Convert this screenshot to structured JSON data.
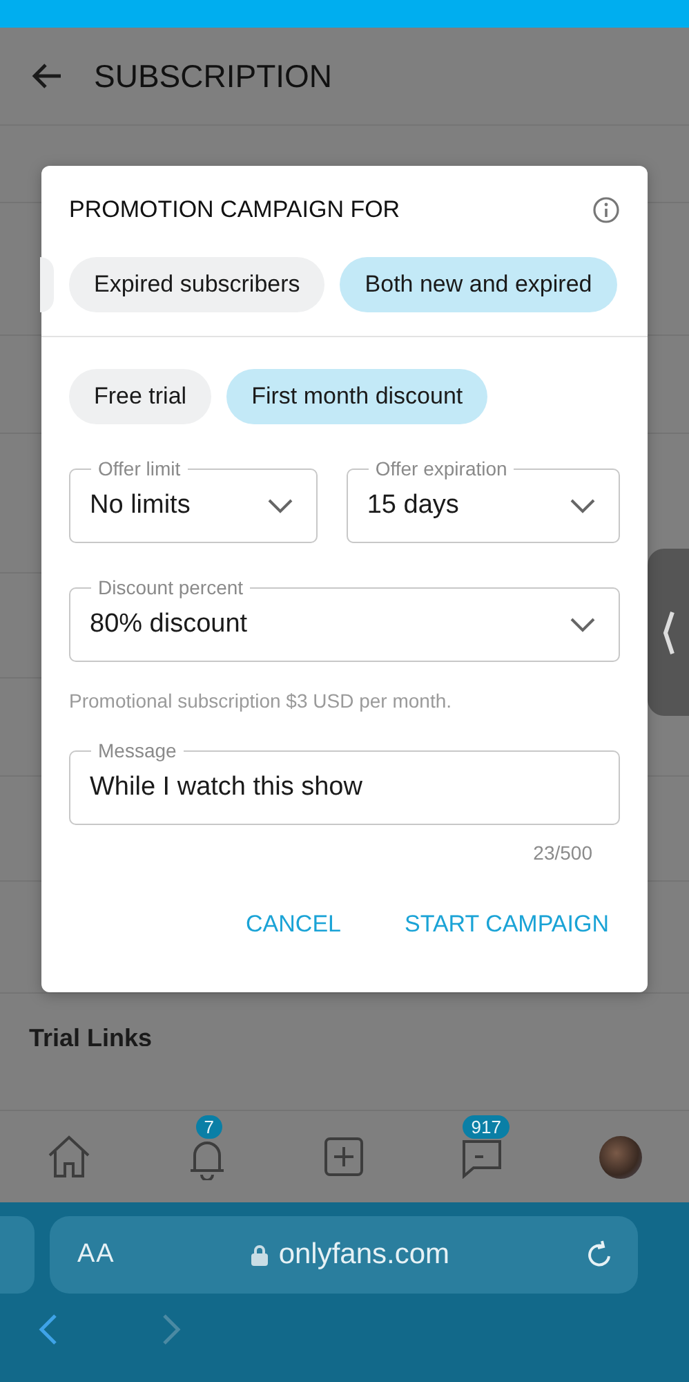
{
  "header": {
    "title": "SUBSCRIPTION"
  },
  "background": {
    "section_title": "Trial Links"
  },
  "dialog": {
    "title": "PROMOTION CAMPAIGN FOR",
    "audience": [
      {
        "label": "Expired subscribers",
        "selected": false
      },
      {
        "label": "Both new and expired",
        "selected": true
      }
    ],
    "offer_types": [
      {
        "label": "Free trial",
        "selected": false
      },
      {
        "label": "First month discount",
        "selected": true
      }
    ],
    "fields": [
      {
        "label": "Offer limit",
        "value": "No limits"
      },
      {
        "label": "Offer expiration",
        "value": "15 days"
      }
    ],
    "discount": {
      "label": "Discount percent",
      "value": "80% discount"
    },
    "note": "Promotional subscription $3 USD per month.",
    "message": {
      "label": "Message",
      "value": "While I watch this show",
      "counter": "23/500"
    },
    "buttons": [
      "CANCEL",
      "START CAMPAIGN"
    ]
  },
  "nav": [
    {
      "kind": "home"
    },
    {
      "kind": "bell",
      "badge": "7"
    },
    {
      "kind": "add"
    },
    {
      "kind": "chat",
      "badge": "917"
    },
    {
      "kind": "avatar"
    }
  ],
  "browser": {
    "text_size": "AA",
    "url": "onlyfans.com"
  }
}
